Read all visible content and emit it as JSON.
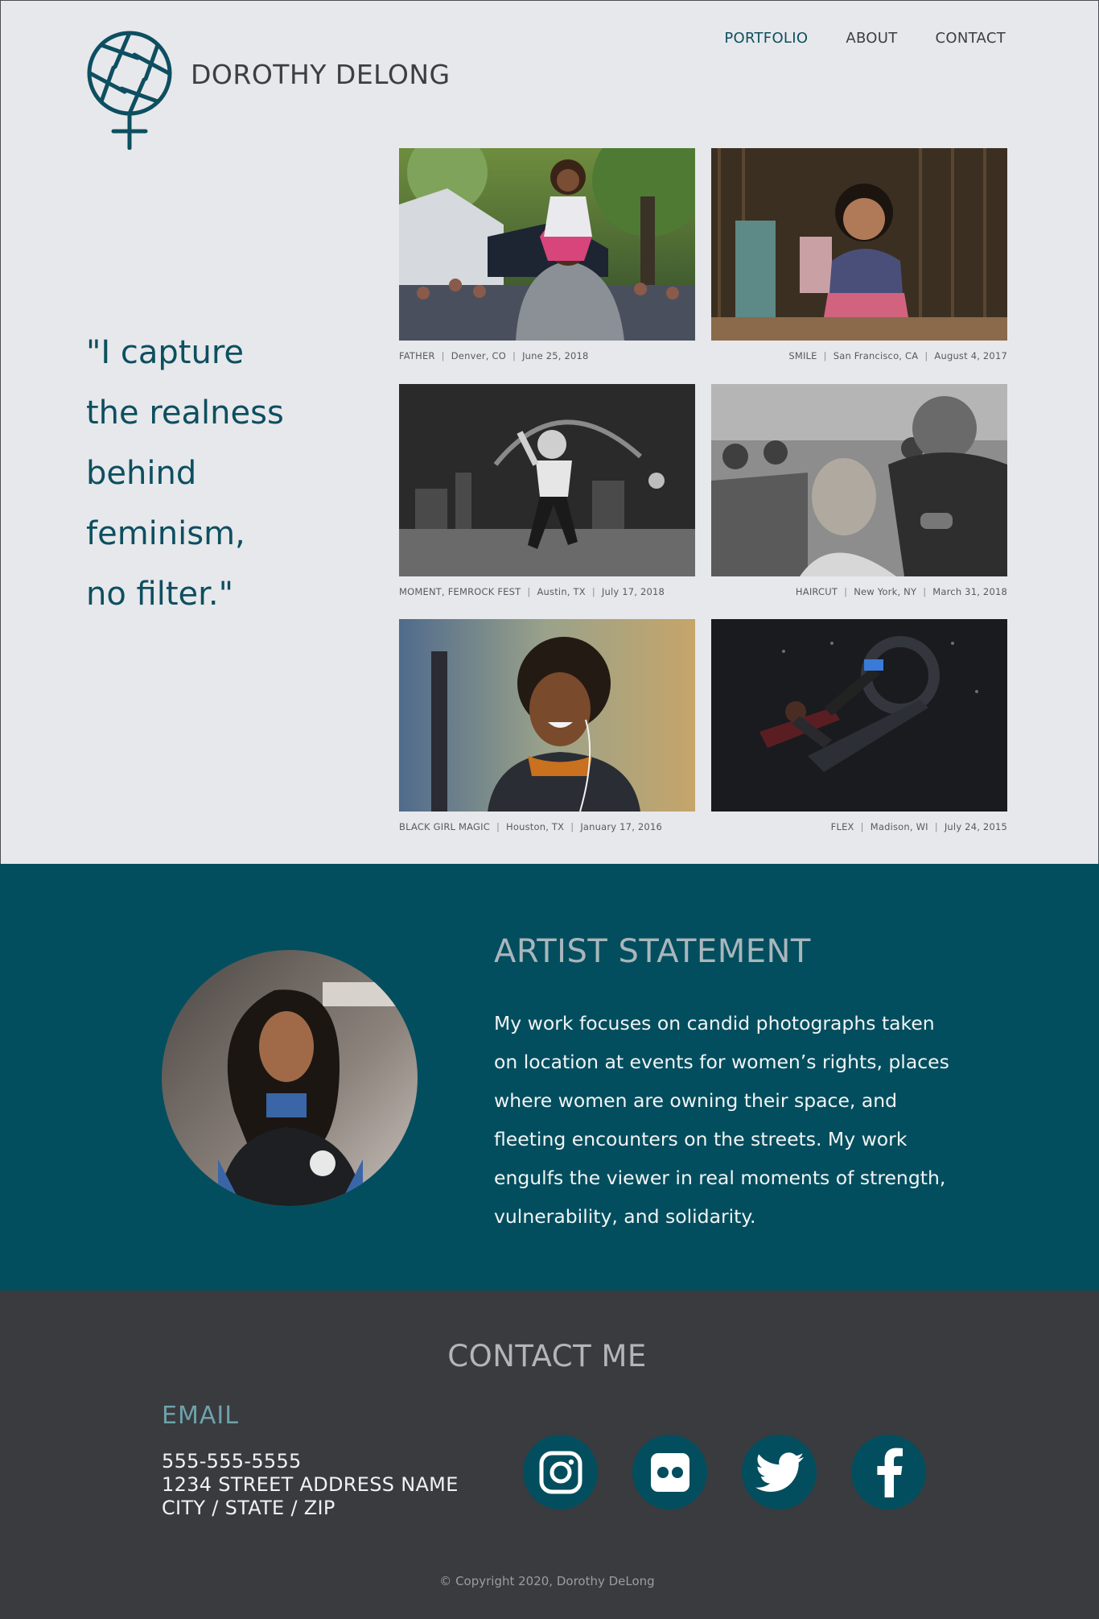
{
  "brand": {
    "name": "DOROTHY DELONG",
    "logo_color": "#0d4f60"
  },
  "nav": {
    "items": [
      {
        "label": "PORTFOLIO",
        "active": true
      },
      {
        "label": "ABOUT",
        "active": false
      },
      {
        "label": "CONTACT",
        "active": false
      }
    ]
  },
  "quote": {
    "lines": [
      "\"I capture",
      "the realness",
      "behind",
      "feminism,",
      "no filter.\""
    ]
  },
  "portfolio": [
    {
      "title": "FATHER",
      "location": "Denver, CO",
      "date": "June 25, 2018"
    },
    {
      "title": "SMILE",
      "location": "San Francisco, CA",
      "date": "August 4, 2017"
    },
    {
      "title": "MOMENT, FEMROCK FEST",
      "location": "Austin, TX",
      "date": "July 17, 2018"
    },
    {
      "title": "HAIRCUT",
      "location": "New York, NY",
      "date": "March 31, 2018"
    },
    {
      "title": "BLACK GIRL MAGIC",
      "location": "Houston, TX",
      "date": "January 17, 2016"
    },
    {
      "title": "FLEX",
      "location": "Madison, WI",
      "date": "July 24, 2015"
    }
  ],
  "artist": {
    "heading": "ARTIST STATEMENT",
    "statement": "My work focuses on candid photographs taken on location at events for women’s rights, places where women are owning their space, and fleeting encounters on the streets. My work engulfs the viewer in real moments of strength, vulnerability, and solidarity."
  },
  "contact": {
    "heading": "CONTACT ME",
    "email_label": "EMAIL",
    "phone": "555-555-5555",
    "street": "1234 STREET ADDRESS NAME",
    "city_line": "CITY  /  STATE  /  ZIP",
    "socials": [
      "instagram-icon",
      "flickr-icon",
      "twitter-icon",
      "facebook-icon"
    ]
  },
  "footer": {
    "copyright": "© Copyright 2020, Dorothy DeLong"
  },
  "colors": {
    "teal": "#034e5e",
    "dark": "#393b3f",
    "light": "#e7e8eb"
  }
}
